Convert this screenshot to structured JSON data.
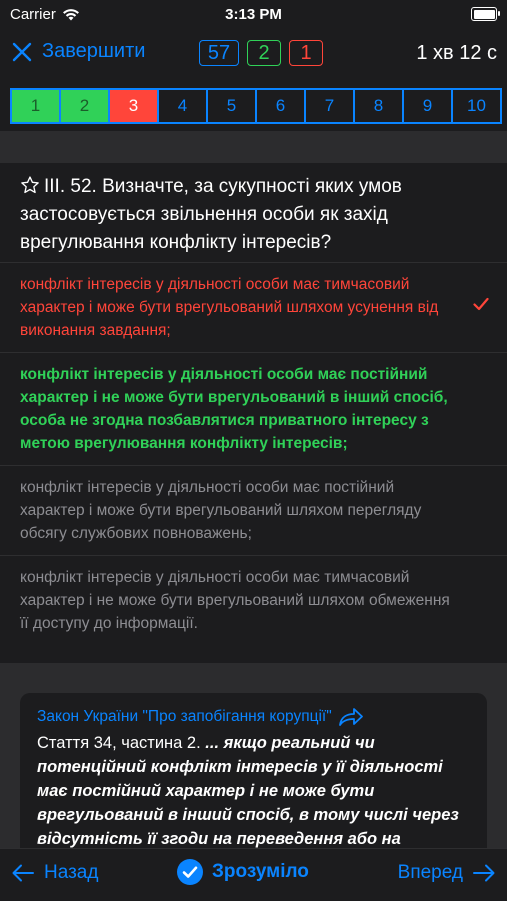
{
  "status": {
    "carrier": "Carrier",
    "time": "3:13 PM"
  },
  "nav": {
    "finish_label": "Завершити",
    "total": "57",
    "correct_count": "2",
    "wrong_count": "1",
    "timer": "1 хв 12 с"
  },
  "strip": {
    "cells": [
      {
        "num": "1",
        "state": "correct"
      },
      {
        "num": "2",
        "state": "correct"
      },
      {
        "num": "3",
        "state": "wrong"
      },
      {
        "num": "4",
        "state": "none"
      },
      {
        "num": "5",
        "state": "none"
      },
      {
        "num": "6",
        "state": "none"
      },
      {
        "num": "7",
        "state": "none"
      },
      {
        "num": "8",
        "state": "none"
      },
      {
        "num": "9",
        "state": "none"
      },
      {
        "num": "10",
        "state": "none"
      }
    ]
  },
  "question": {
    "text": "ІІІ. 52. Визначте, за сукупності яких умов застосовується звільнення особи як захід врегулювання конфлікту інтересів?",
    "answers": [
      "конфлікт інтересів у діяльності особи має тимчасовий характер і може бути врегульований шляхом усунення від виконання завдання;",
      "конфлікт інтересів у діяльності особи має постійний характер і не може бути врегульований в інший спосіб, особа не згодна позбавлятися приватного інтересу з метою врегулювання конфлікту інтересів;",
      "конфлікт інтересів у діяльності особи має постійний характер і може бути врегульований шляхом перегляду обсягу службових повноважень;",
      "конфлікт інтересів у діяльності особи має тимчасовий характер і не може бути врегульований шляхом обмеження її доступу до інформації."
    ]
  },
  "explanation": {
    "law_link": "Закон України \"Про запобігання корупції\"",
    "article": "Стаття 34, частина 2.",
    "quote": "... якщо реальний чи потенційний конфлікт інтересів у її діяльності має постійний характер і не може бути врегульований в інший спосіб, в тому числі через відсутність її згоди на переведення або на"
  },
  "bottom": {
    "back_label": "Назад",
    "understood_label": "Зрозуміло",
    "forward_label": "Вперед"
  },
  "colors": {
    "accent": "#0a84ff",
    "correct": "#30d158",
    "wrong": "#ff453a"
  }
}
